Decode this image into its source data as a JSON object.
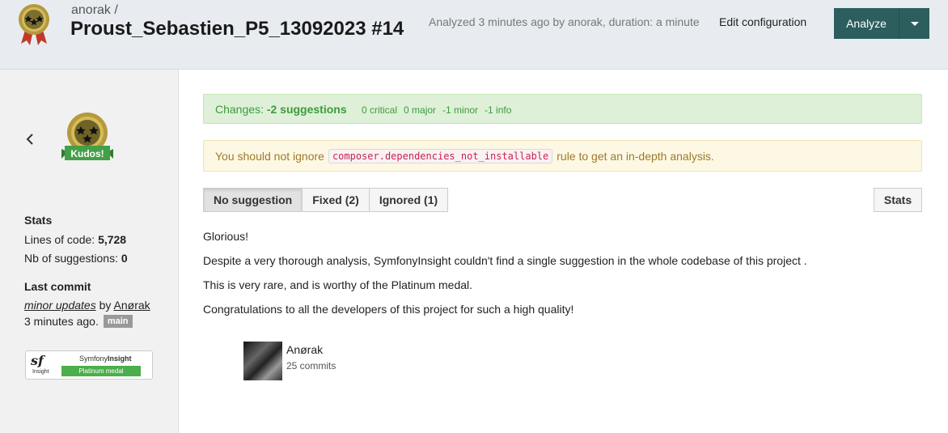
{
  "header": {
    "owner": "anorak /",
    "project_title": "Proust_Sebastien_P5_13092023 #14",
    "analyzed_text": "Analyzed 3 minutes ago by anorak, duration: a minute",
    "edit_config_label": "Edit configuration",
    "analyze_label": "Analyze",
    "medal_icon": "medal-ribbon-icon"
  },
  "sidebar": {
    "kudos_label": "Kudos!",
    "stats_title": "Stats",
    "lines_of_code_label": "Lines of code:",
    "lines_of_code_value": "5,728",
    "suggestions_label": "Nb of suggestions:",
    "suggestions_value": "0",
    "last_commit_title": "Last commit",
    "commit_message": "minor updates",
    "commit_by": " by ",
    "commit_author": "Anørak",
    "commit_time": "3 minutes ago.",
    "branch": "main",
    "badge": {
      "sf": "sf",
      "insight_small": "Insight",
      "brand_prefix": "Symfony",
      "brand_suffix": "Insight",
      "medal": "Platinum medal"
    }
  },
  "main": {
    "changes_label": "Changes:",
    "changes_value": "-2 suggestions",
    "counts": [
      "0 critical",
      "0 major",
      "-1 minor",
      "-1 info"
    ],
    "warning_prefix": "You should not ignore",
    "warning_code": "composer.dependencies_not_installable",
    "warning_suffix": "rule to get an in-depth analysis.",
    "tabs": [
      {
        "label": "No suggestion",
        "active": true
      },
      {
        "label": "Fixed (2)",
        "active": false
      },
      {
        "label": "Ignored (1)",
        "active": false
      }
    ],
    "stats_button": "Stats",
    "paragraphs": [
      "Glorious!",
      "Despite a very thorough analysis, SymfonyInsight couldn't find a single suggestion in the whole codebase of this project .",
      "This is very rare, and is worthy of the Platinum medal.",
      "Congratulations to all the developers of this project for such a high quality!"
    ],
    "contributor": {
      "name": "Anørak",
      "commits": "25 commits"
    }
  },
  "colors": {
    "header_bg": "#e8ecf0",
    "analyze_btn": "#2d5e5e",
    "success_bg": "#dff0d8",
    "success_text": "#3c9c3c",
    "warning_bg": "#fcf8e3",
    "warning_text": "#a0792c",
    "platinum_green": "#4cae4c"
  }
}
